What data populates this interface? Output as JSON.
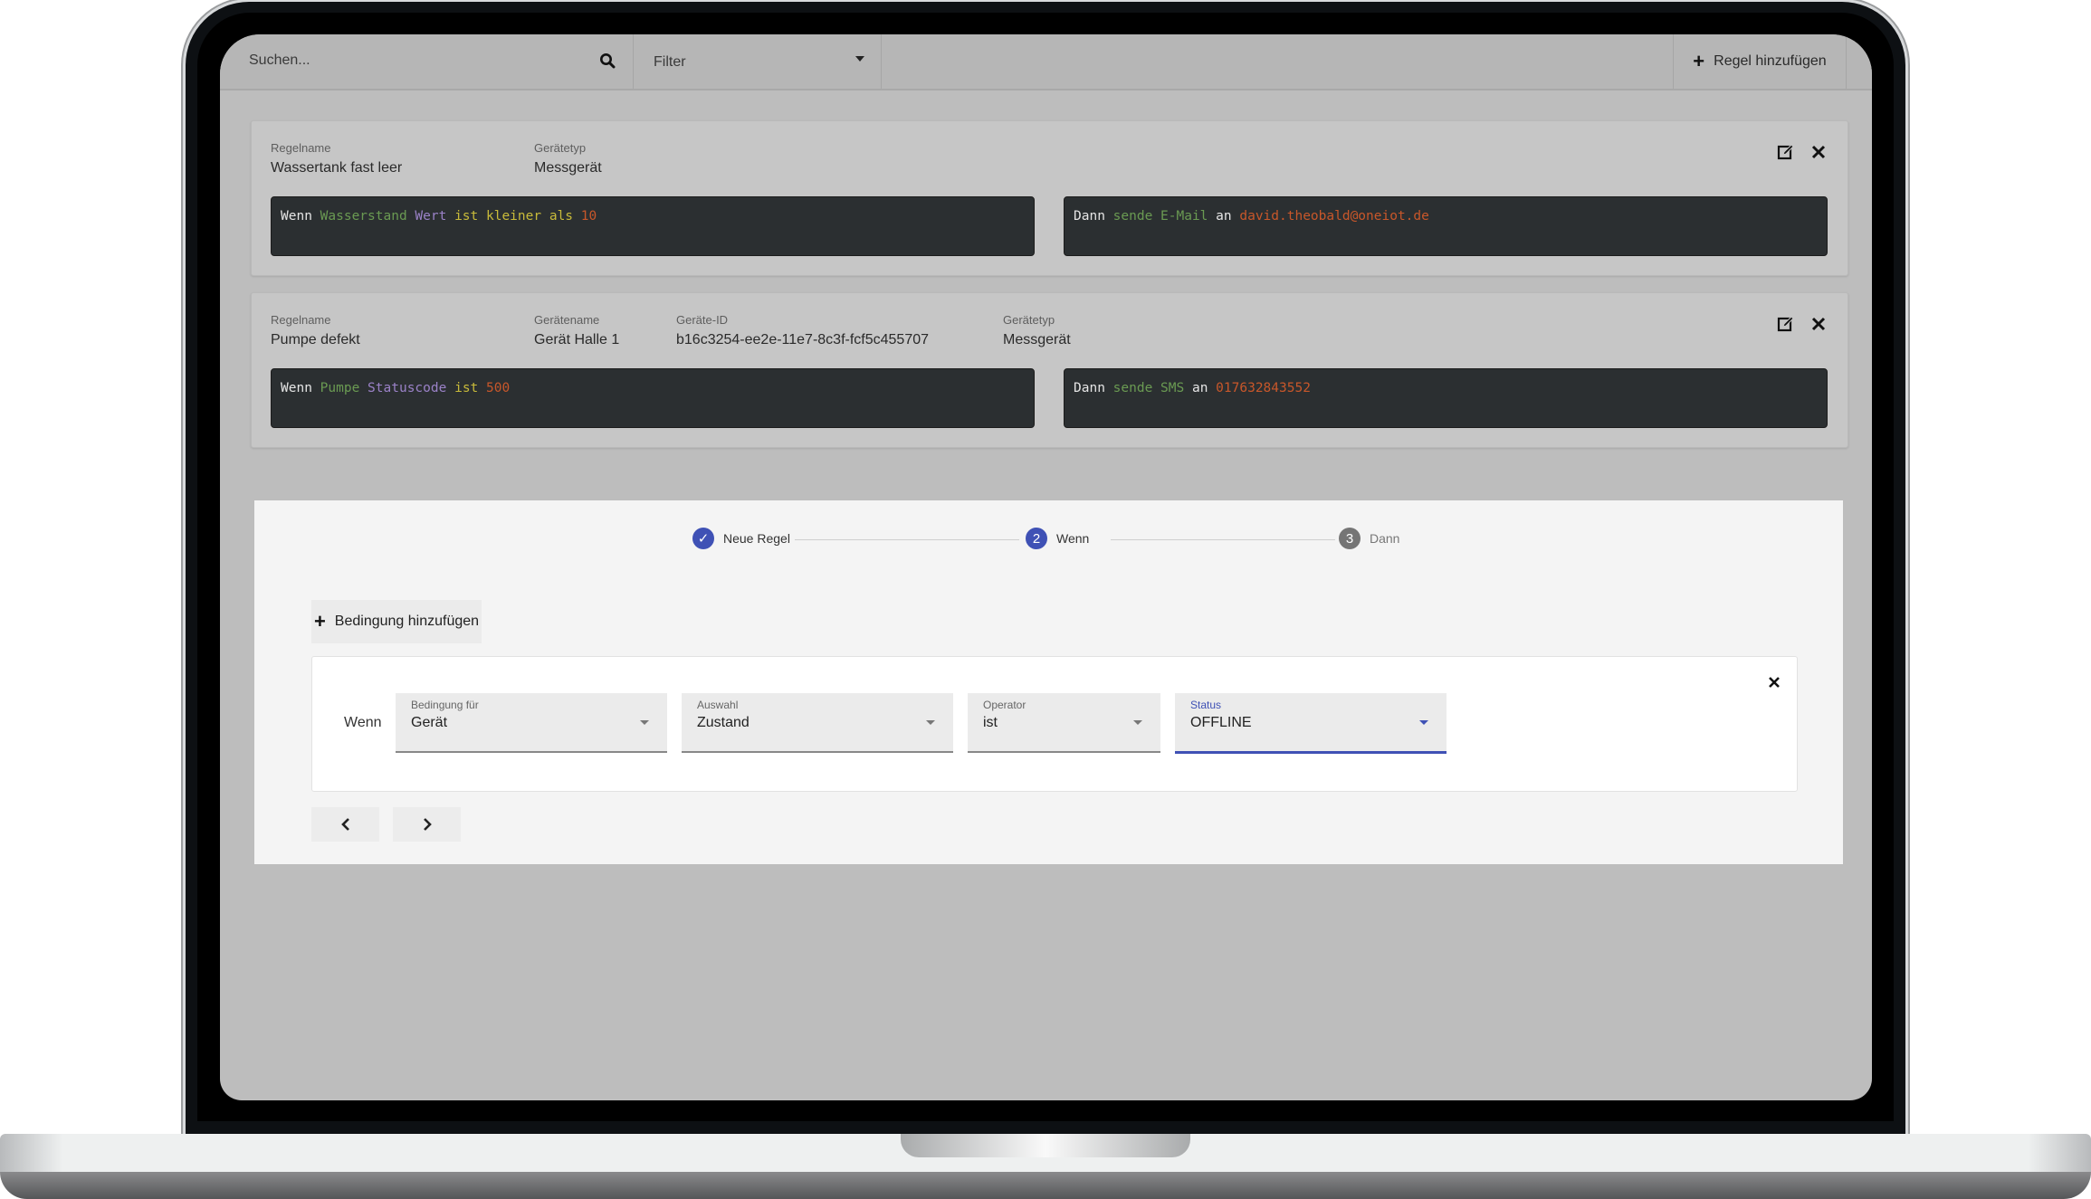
{
  "topbar": {
    "search_placeholder": "Suchen...",
    "search_icon": "search-icon",
    "filter_label": "Filter",
    "add_rule_label": "Regel hinzufügen"
  },
  "rules": [
    {
      "fields": [
        {
          "label": "Regelname",
          "value": "Wassertank fast leer"
        },
        {
          "label": "Gerätetyp",
          "value": "Messgerät"
        }
      ],
      "condition": [
        {
          "text": "Wenn",
          "color": "kw"
        },
        {
          "text": "Wasserstand",
          "color": "green"
        },
        {
          "text": "Wert",
          "color": "purple"
        },
        {
          "text": "ist kleiner als",
          "color": "yellow"
        },
        {
          "text": "10",
          "color": "orange"
        }
      ],
      "action": [
        {
          "text": "Dann",
          "color": "kw"
        },
        {
          "text": "sende E-Mail",
          "color": "green"
        },
        {
          "text": "an",
          "color": "white"
        },
        {
          "text": "david.theobald@oneiot.de",
          "color": "orange"
        }
      ]
    },
    {
      "fields": [
        {
          "label": "Regelname",
          "value": "Pumpe defekt"
        },
        {
          "label": "Gerätename",
          "value": "Gerät Halle 1"
        },
        {
          "label": "Geräte-ID",
          "value": "b16c3254-ee2e-11e7-8c3f-fcf5c455707"
        },
        {
          "label": "Gerätetyp",
          "value": "Messgerät"
        }
      ],
      "condition": [
        {
          "text": "Wenn",
          "color": "kw"
        },
        {
          "text": "Pumpe",
          "color": "green"
        },
        {
          "text": "Statuscode",
          "color": "purple"
        },
        {
          "text": "ist",
          "color": "yellow"
        },
        {
          "text": "500",
          "color": "orange"
        }
      ],
      "action": [
        {
          "text": "Dann",
          "color": "kw"
        },
        {
          "text": "sende SMS",
          "color": "green"
        },
        {
          "text": "an",
          "color": "white"
        },
        {
          "text": "017632843552",
          "color": "orange"
        }
      ]
    }
  ],
  "wizard": {
    "steps": [
      {
        "label": "Neue Regel",
        "marker": "✓",
        "state": "done"
      },
      {
        "label": "Wenn",
        "marker": "2",
        "state": "active"
      },
      {
        "label": "Dann",
        "marker": "3",
        "state": "pending"
      }
    ],
    "add_condition_label": "Bedingung hinzufügen",
    "condition_prefix": "Wenn",
    "selects": [
      {
        "label": "Bedingung für",
        "value": "Gerät"
      },
      {
        "label": "Auswahl",
        "value": "Zustand"
      },
      {
        "label": "Operator",
        "value": "ist"
      },
      {
        "label": "Status",
        "value": "OFFLINE",
        "focused": true
      }
    ],
    "prev_icon": "chevron-left-icon",
    "next_icon": "chevron-right-icon"
  },
  "colors": {
    "accent": "#3f51b5",
    "code_bg": "#2b2f31",
    "step_pending": "#757575"
  }
}
